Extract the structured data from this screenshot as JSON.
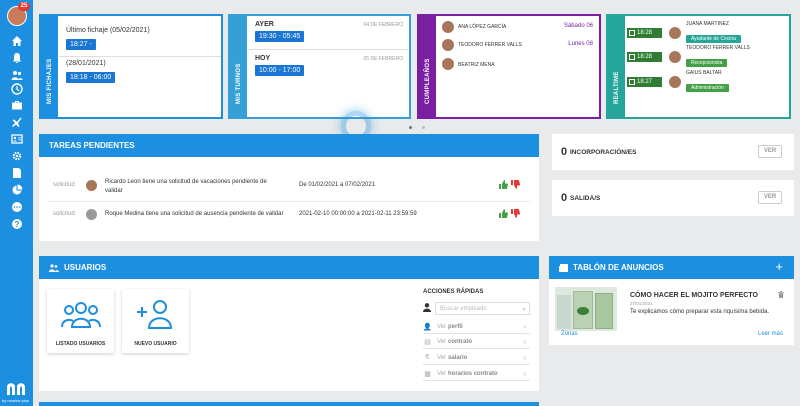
{
  "sidebar": {
    "notification_count": "25",
    "icons": [
      "home-icon",
      "bell-icon",
      "users-icon",
      "clock-icon",
      "briefcase-icon",
      "plane-icon",
      "id-card-icon",
      "cogs-icon",
      "document-icon",
      "pie-chart-icon",
      "chat-icon",
      "help-icon"
    ],
    "brand": "by nomina plus"
  },
  "fichajes": {
    "tab_label": "MIS FICHAJES",
    "entries": [
      {
        "title": "Último fichaje (05/02/2021)",
        "time": "18:27 -"
      },
      {
        "title": "(28/01/2021)",
        "time": "18:18 - 06:00"
      }
    ]
  },
  "turnos": {
    "tab_label": "MIS TURNOS",
    "entries": [
      {
        "day": "AYER",
        "date": "04 DE FEBRERO",
        "time": "19:30 - 05:45"
      },
      {
        "day": "HOY",
        "date": "05 DE FEBRERO",
        "time": "10:00 - 17:00"
      }
    ]
  },
  "cumpleanos": {
    "tab_label": "CUMPLEAÑOS",
    "entries": [
      {
        "name": "ANA LÓPEZ GARCÍA",
        "date": "Sábado 06"
      },
      {
        "name": "TEODORO FERRER VALLS",
        "date": "Lunes 08"
      },
      {
        "name": "BEATRIZ MENA",
        "date": "Lunes 08"
      }
    ]
  },
  "realtime": {
    "tab_label": "REALTIME",
    "entries": [
      {
        "time": "18:28",
        "name": "JUANA MARTINEZ",
        "role": "Ayudante de Cocina"
      },
      {
        "time": "18:28",
        "name": "TEODORO FERRER VALLS",
        "role": "Recepcionista"
      },
      {
        "time": "18:27",
        "name": "GAIUS BALTAR",
        "role": "Administración"
      }
    ]
  },
  "tareas": {
    "title": "TAREAS PENDIENTES",
    "rows": [
      {
        "type": "solicitud",
        "text": "Ricardo Leon tiene una solicitud de vacaciones pendiente de validar",
        "range": "De 01/02/2021 a 07/02/2021"
      },
      {
        "type": "solicitud",
        "text": "Roque Medina tiene una solicitud de ausencia pendiente de validar",
        "range": "2021-02-10 00:00:00 a 2021-02-11 23:59:59"
      }
    ]
  },
  "incorporacion": {
    "count": "0",
    "label": "INCORPORACIÓN/ES",
    "button": "VER"
  },
  "salida": {
    "count": "0",
    "label": "SALIDA/S",
    "button": "VER"
  },
  "usuarios": {
    "title": "USUARIOS",
    "tiles": [
      "LISTADO USUARIOS",
      "NUEVO USUARIO"
    ],
    "quick_actions": {
      "title": "ACCIONES RÁPIDAS",
      "search_placeholder": "Buscar empleado",
      "items": [
        {
          "prefix": "Ver",
          "label": "perfil"
        },
        {
          "prefix": "Ver",
          "label": "contrato"
        },
        {
          "prefix": "Ver",
          "label": "salario"
        },
        {
          "prefix": "Ver",
          "label": "horarios contrato"
        }
      ]
    }
  },
  "tablon": {
    "title": "TABLÓN DE ANUNCIOS",
    "post_title": "CÓMO HACER EL MOJITO PERFECTO",
    "post_date": "27/01/2021",
    "post_body": "Te explicamos cómo preparar esta riquísima bebida.",
    "category": "Zonas",
    "more": "Leer más"
  },
  "colors": {
    "accent": "#1d8fe0",
    "fichajes": "#1d8fe0",
    "turnos": "#35a0d6",
    "cumple": "#7b1fa2",
    "realtime": "#26a69a"
  }
}
